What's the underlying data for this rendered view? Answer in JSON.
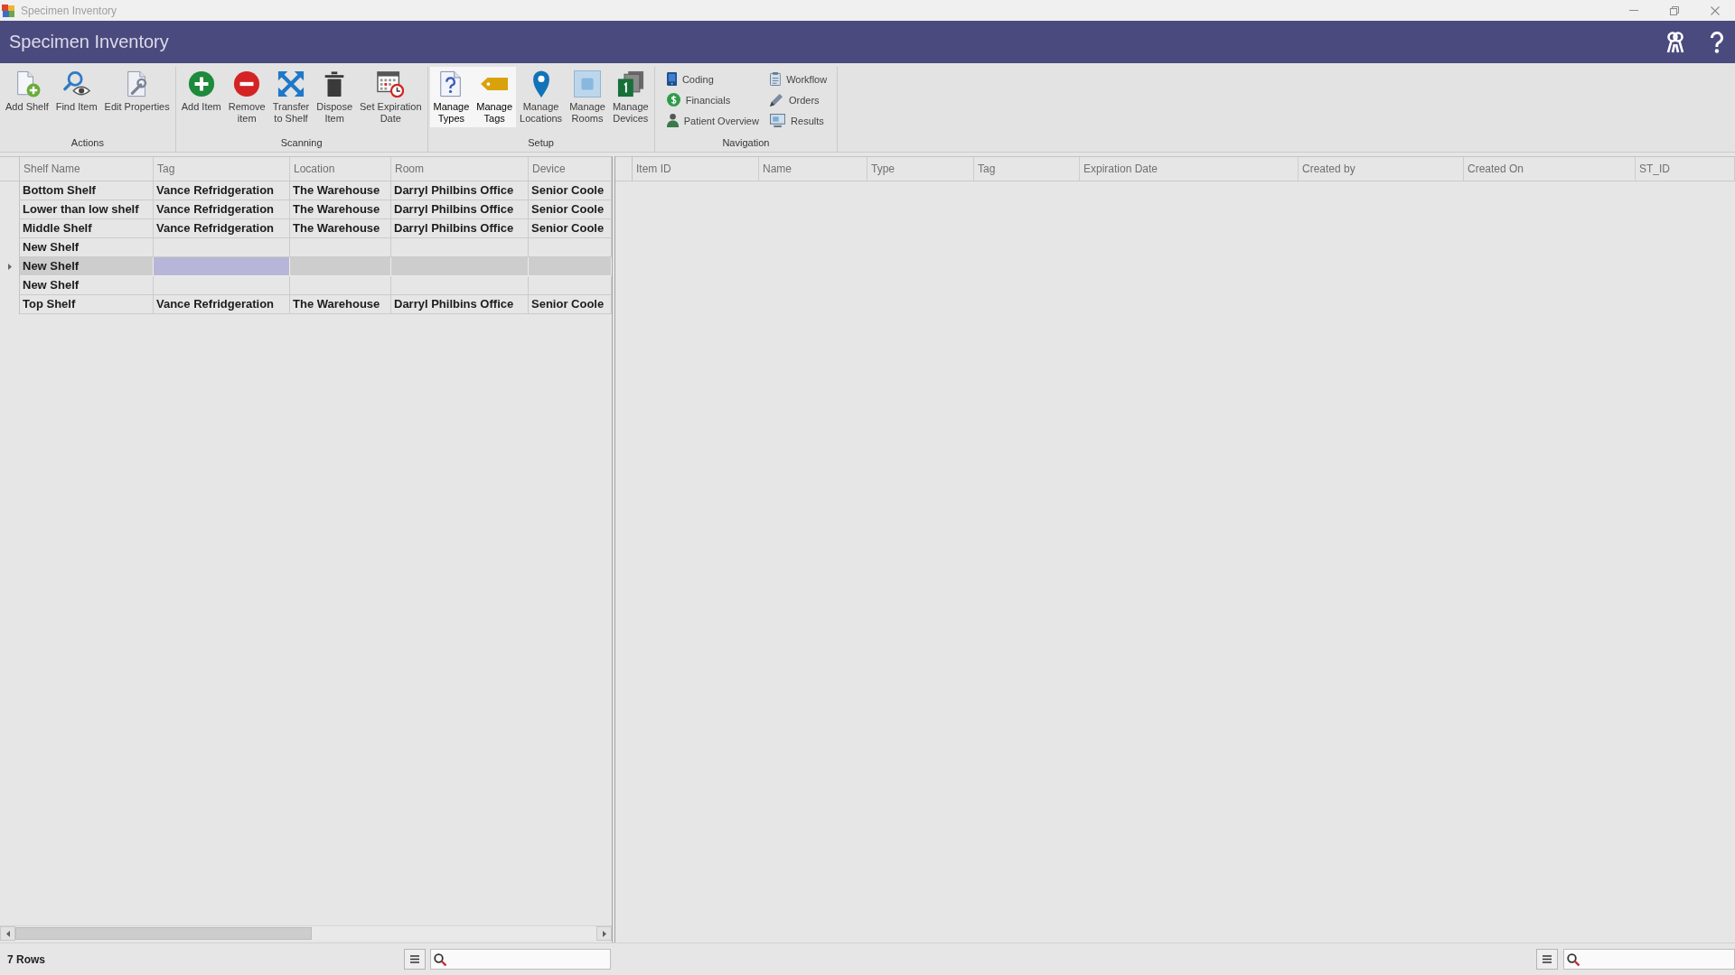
{
  "window": {
    "title": "Specimen Inventory"
  },
  "header": {
    "title": "Specimen Inventory"
  },
  "ribbon": {
    "groups": [
      {
        "label": "Actions",
        "kind": "large",
        "buttons": [
          {
            "label": "Add Shelf",
            "highlighted": false
          },
          {
            "label": "Find Item",
            "highlighted": false
          },
          {
            "label": "Edit Properties",
            "highlighted": false
          }
        ]
      },
      {
        "label": "Scanning",
        "kind": "large",
        "buttons": [
          {
            "label": "Add Item",
            "highlighted": false
          },
          {
            "label": "Remove\nitem",
            "highlighted": false
          },
          {
            "label": "Transfer\nto Shelf",
            "highlighted": false
          },
          {
            "label": "Dispose\nItem",
            "highlighted": false
          },
          {
            "label": "Set Expiration\nDate",
            "highlighted": false
          }
        ]
      },
      {
        "label": "Setup",
        "kind": "large",
        "buttons": [
          {
            "label": "Manage\nTypes",
            "highlighted": true
          },
          {
            "label": "Manage\nTags",
            "highlighted": true
          },
          {
            "label": "Manage\nLocations",
            "highlighted": false
          },
          {
            "label": "Manage\nRooms",
            "highlighted": false
          },
          {
            "label": "Manage\nDevices",
            "highlighted": false
          }
        ]
      },
      {
        "label": "Navigation",
        "kind": "small",
        "buttons": [
          {
            "label": "Coding",
            "highlighted": false
          },
          {
            "label": "Financials",
            "highlighted": false
          },
          {
            "label": "Patient Overview",
            "highlighted": false
          },
          {
            "label": "Workflow",
            "highlighted": false
          },
          {
            "label": "Orders",
            "highlighted": false
          },
          {
            "label": "Results",
            "highlighted": false
          }
        ]
      }
    ]
  },
  "left_table": {
    "columns": [
      "Shelf Name",
      "Tag",
      "Location",
      "Room",
      "Device"
    ],
    "rows": [
      {
        "selected": false,
        "cells": [
          {
            "text": "Bottom Shelf",
            "focused": false
          },
          {
            "text": "Vance Refridgeration",
            "focused": false
          },
          {
            "text": "The Warehouse",
            "focused": false
          },
          {
            "text": "Darryl Philbins Office",
            "focused": false
          },
          {
            "text": "Senior Coole",
            "focused": false
          }
        ]
      },
      {
        "selected": false,
        "cells": [
          {
            "text": "Lower than low shelf",
            "focused": false
          },
          {
            "text": "Vance Refridgeration",
            "focused": false
          },
          {
            "text": "The Warehouse",
            "focused": false
          },
          {
            "text": "Darryl Philbins Office",
            "focused": false
          },
          {
            "text": "Senior Coole",
            "focused": false
          }
        ]
      },
      {
        "selected": false,
        "cells": [
          {
            "text": "Middle Shelf",
            "focused": false
          },
          {
            "text": "Vance Refridgeration",
            "focused": false
          },
          {
            "text": "The Warehouse",
            "focused": false
          },
          {
            "text": "Darryl Philbins Office",
            "focused": false
          },
          {
            "text": "Senior Coole",
            "focused": false
          }
        ]
      },
      {
        "selected": false,
        "cells": [
          {
            "text": "New Shelf",
            "focused": false
          },
          {
            "focused": false
          },
          {
            "focused": false
          },
          {
            "focused": false
          },
          {
            "focused": false
          }
        ]
      },
      {
        "selected": true,
        "cells": [
          {
            "text": "New Shelf",
            "focused": false
          },
          {
            "focused": true
          },
          {
            "focused": false
          },
          {
            "focused": false
          },
          {
            "focused": false
          }
        ]
      },
      {
        "selected": false,
        "cells": [
          {
            "text": "New Shelf",
            "focused": false
          },
          {
            "focused": false
          },
          {
            "focused": false
          },
          {
            "focused": false
          },
          {
            "focused": false
          }
        ]
      },
      {
        "selected": false,
        "cells": [
          {
            "text": "Top Shelf",
            "focused": false
          },
          {
            "text": "Vance Refridgeration",
            "focused": false
          },
          {
            "text": "The Warehouse",
            "focused": false
          },
          {
            "text": "Darryl Philbins Office",
            "focused": false
          },
          {
            "text": "Senior Coole",
            "focused": false
          }
        ]
      }
    ]
  },
  "right_table": {
    "columns": [
      "Item ID",
      "Name",
      "Type",
      "Tag",
      "Expiration Date",
      "Created by",
      "Created On",
      "ST_ID"
    ]
  },
  "status_bar": {
    "row_count": "7 Rows"
  }
}
